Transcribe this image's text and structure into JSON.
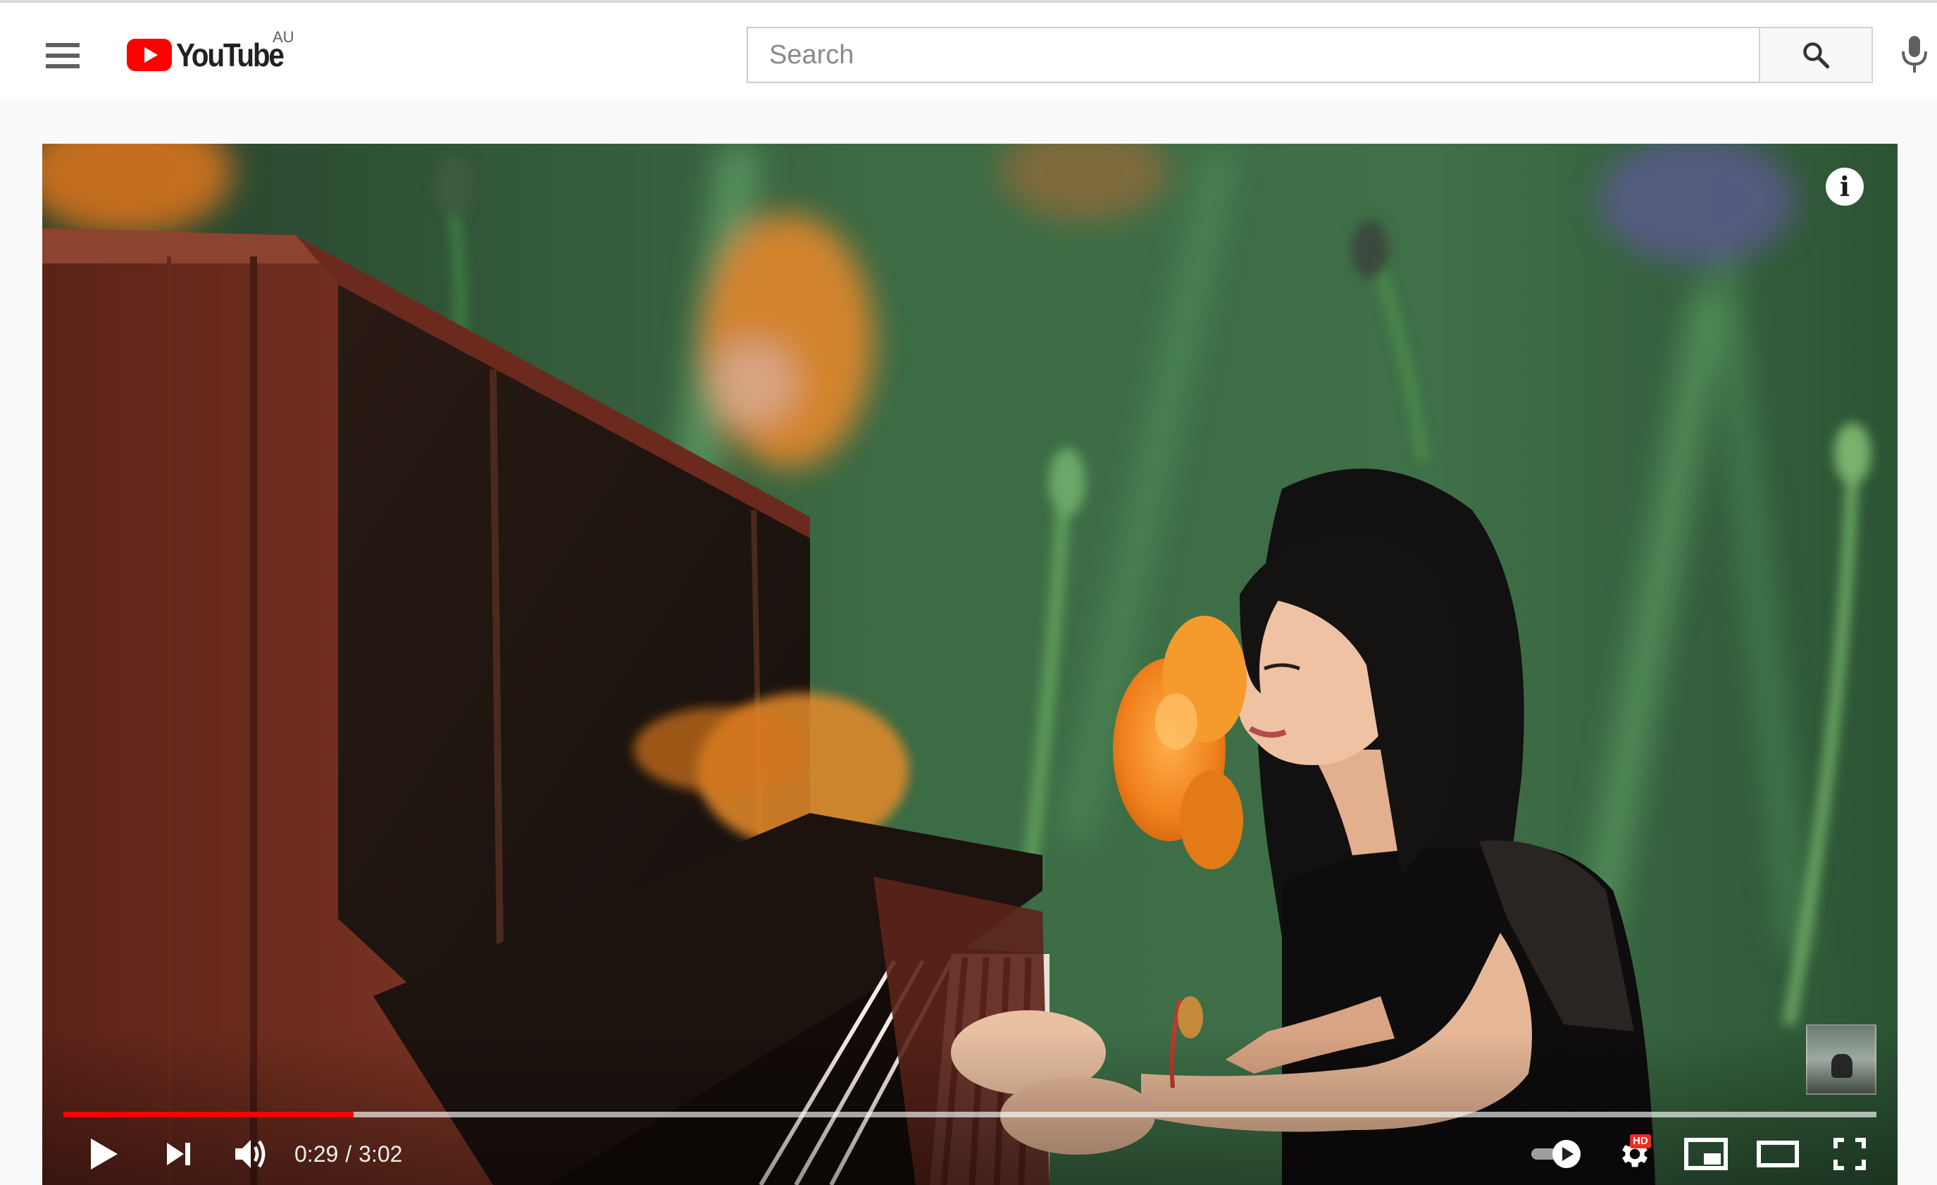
{
  "masthead": {
    "logo_text": "YouTube",
    "region": "AU",
    "search_placeholder": "Search",
    "search_value": ""
  },
  "player": {
    "current_time": "0:29",
    "separator": "/",
    "duration": "3:02",
    "progress_fraction": 0.16,
    "loaded_fraction": 1.0,
    "quality_badge": "HD",
    "accent_color": "#ff0000",
    "icons": [
      "play-icon",
      "next-icon",
      "volume-icon",
      "autoplay-toggle-icon",
      "settings-icon",
      "miniplayer-icon",
      "theater-mode-icon",
      "fullscreen-icon",
      "info-icon"
    ]
  }
}
